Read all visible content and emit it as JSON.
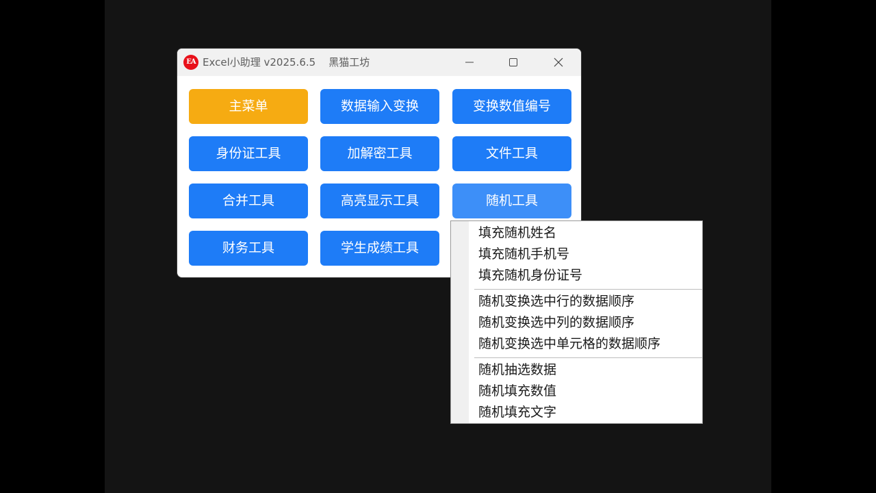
{
  "window": {
    "title": "Excel小助理 v2025.6.5    黑猫工坊",
    "logo_text": "EA",
    "controls": {
      "minimize_icon": "minimize-icon",
      "maximize_icon": "maximize-icon",
      "close_icon": "close-icon"
    }
  },
  "buttons": {
    "main_menu": "主菜单",
    "data_input_transform": "数据输入变换",
    "transform_number_code": "变换数值编号",
    "id_card_tools": "身份证工具",
    "encrypt_decrypt_tools": "加解密工具",
    "file_tools": "文件工具",
    "merge_tools": "合并工具",
    "highlight_tools": "高亮显示工具",
    "random_tools": "随机工具",
    "finance_tools": "财务工具",
    "student_score_tools": "学生成绩工具"
  },
  "random_menu": {
    "group1": [
      "填充随机姓名",
      "填充随机手机号",
      "填充随机身份证号"
    ],
    "group2": [
      "随机变换选中行的数据顺序",
      "随机变换选中列的数据顺序",
      "随机变换选中单元格的数据顺序"
    ],
    "group3": [
      "随机抽选数据",
      "随机填充数值",
      "随机填充文字"
    ]
  },
  "colors": {
    "primary_button": "#1e7cf7",
    "main_menu_button": "#f6ab12",
    "hovered_button": "#3d8ff8",
    "logo": "#e8101a"
  }
}
